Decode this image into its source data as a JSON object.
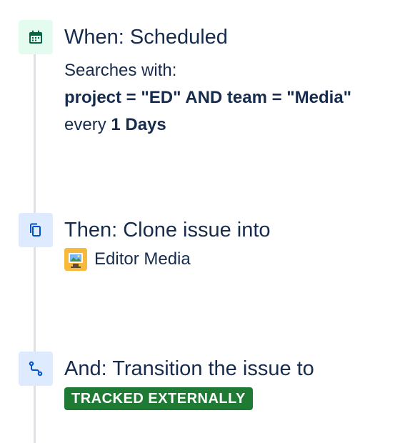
{
  "steps": {
    "trigger": {
      "icon": "calendar-icon",
      "title": "When: Scheduled",
      "searches_label": "Searches with:",
      "query": "project = \"ED\" AND team = \"Media\"",
      "every_label": "every",
      "interval": "1 Days"
    },
    "clone": {
      "icon": "clone-icon",
      "title": "Then: Clone issue into",
      "project_name": "Editor Media"
    },
    "transition": {
      "icon": "transition-icon",
      "title": "And: Transition the issue to",
      "status": "TRACKED EXTERNALLY"
    }
  },
  "colors": {
    "text": "#172b4d",
    "trigger_bg": "#e3fcef",
    "trigger_icon": "#006644",
    "action_bg": "#deebff",
    "action_icon": "#0052cc",
    "status_green": "#1f7a34",
    "timeline": "#dfe1e6"
  }
}
